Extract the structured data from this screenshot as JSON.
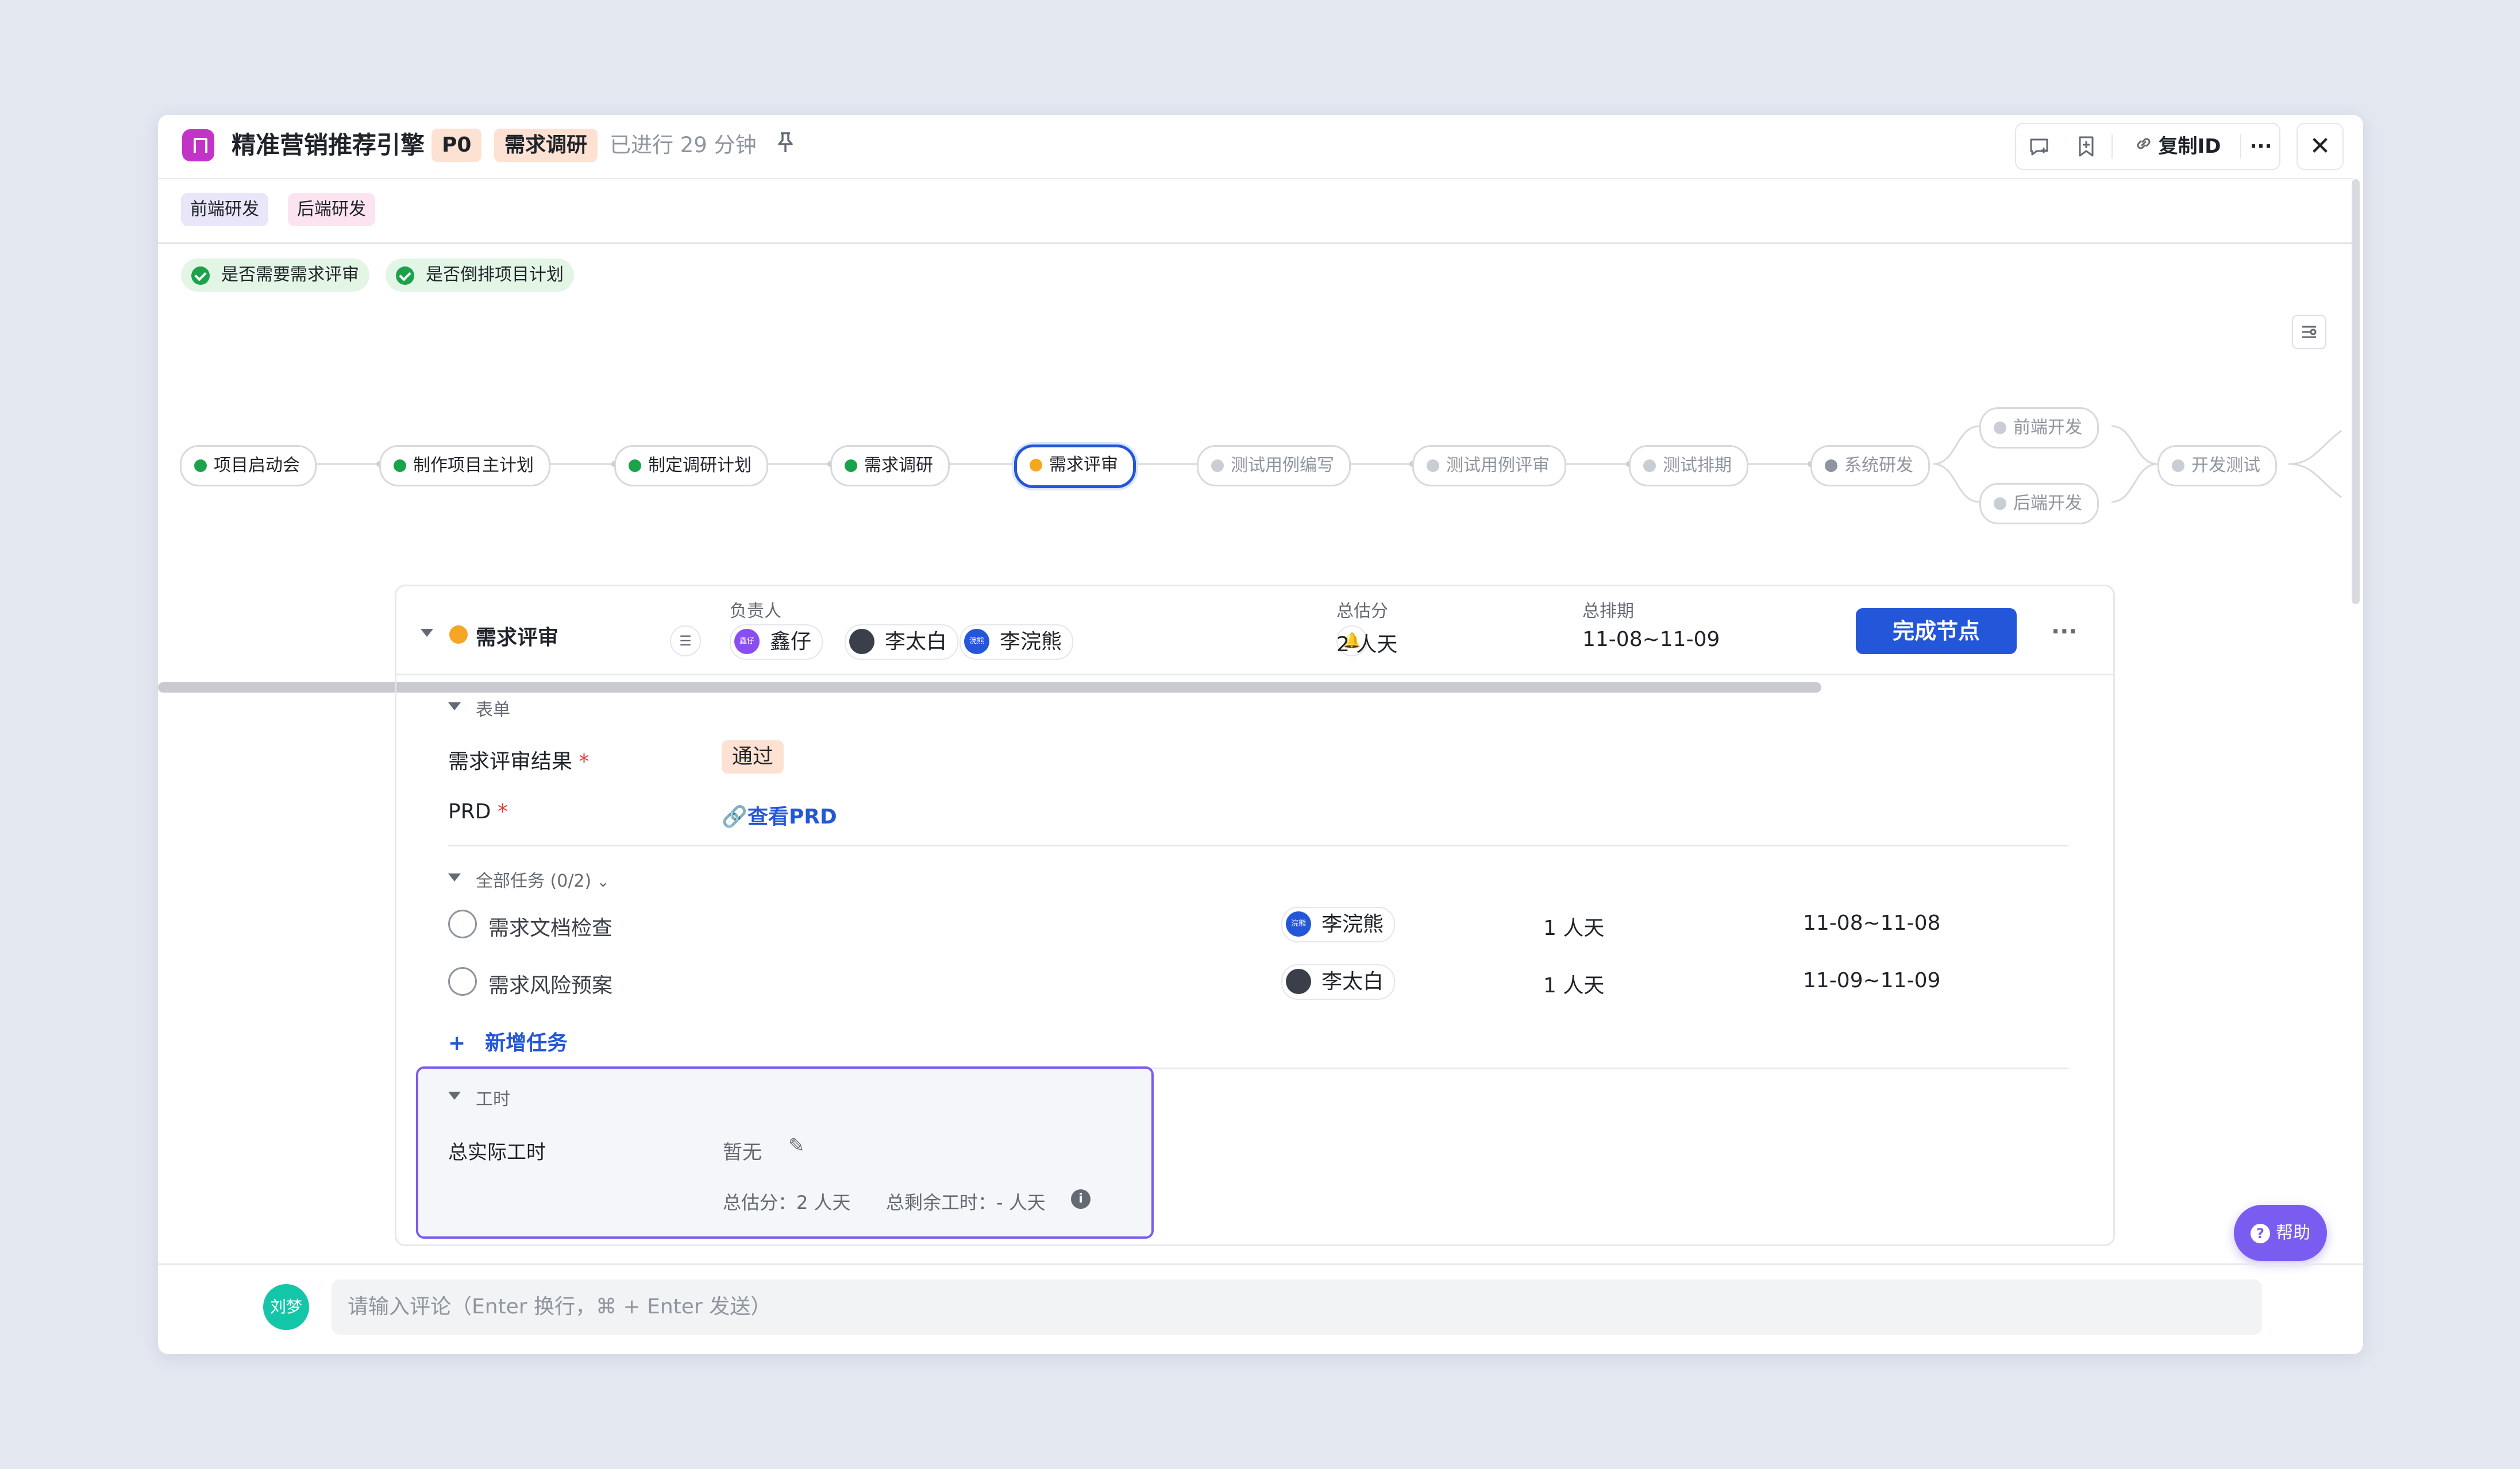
{
  "header": {
    "title": "精准营销推荐引擎",
    "priority": "P0",
    "stage": "需求调研",
    "elapsed": "已进行 29 分钟",
    "copy_id_label": "复制ID"
  },
  "tags": [
    "前端研发",
    "后端研发"
  ],
  "conditions": [
    "是否需要需求评审",
    "是否倒排项目计划"
  ],
  "flow": {
    "nodes": [
      {
        "label": "项目启动会",
        "status": "done"
      },
      {
        "label": "制作项目主计划",
        "status": "done"
      },
      {
        "label": "制定调研计划",
        "status": "done"
      },
      {
        "label": "需求调研",
        "status": "done"
      },
      {
        "label": "需求评审",
        "status": "current"
      },
      {
        "label": "测试用例编写",
        "status": "todo"
      },
      {
        "label": "测试用例评审",
        "status": "todo"
      },
      {
        "label": "测试排期",
        "status": "todo"
      },
      {
        "label": "系统研发",
        "status": "todo"
      },
      {
        "label": "前端开发",
        "status": "todo"
      },
      {
        "label": "后端开发",
        "status": "todo"
      },
      {
        "label": "开发测试",
        "status": "todo"
      }
    ]
  },
  "node_detail": {
    "name": "需求评审",
    "owner_label": "负责人",
    "owners": [
      "鑫仔",
      "李太白",
      "李浣熊"
    ],
    "estimate_label": "总估分",
    "estimate": "2 人天",
    "schedule_label": "总排期",
    "schedule": "11-08~11-09",
    "complete_label": "完成节点",
    "form": {
      "section_label": "表单",
      "fields": [
        {
          "label": "需求评审结果",
          "required": "*",
          "value": "通过"
        },
        {
          "label": "PRD",
          "required": "*",
          "value": "查看PRD"
        }
      ]
    },
    "tasks": {
      "section_label": "全部任务 (0/2)",
      "items": [
        {
          "name": "需求文档检查",
          "assignee": "李浣熊",
          "estimate": "1 人天",
          "schedule": "11-08~11-08"
        },
        {
          "name": "需求风险预案",
          "assignee": "李太白",
          "estimate": "1 人天",
          "schedule": "11-09~11-09"
        }
      ],
      "add_label": "新增任务"
    },
    "work_hours": {
      "section_label": "工时",
      "actual_label": "总实际工时",
      "actual_value": "暂无",
      "summary_estimate": "总估分：2 人天",
      "summary_remaining": "总剩余工时：- 人天"
    }
  },
  "avatar_tiny": {
    "xinzai": "鑫仔",
    "huanxiong": "浣熊"
  },
  "comment": {
    "user": "刘梦",
    "placeholder": "请输入评论（Enter 换行，⌘ + Enter 发送）"
  },
  "help_label": "帮助",
  "colors": {
    "accent": "#2356d9",
    "done": "#1aa34a",
    "current": "#f5a623",
    "highlight": "#7b5cf0"
  }
}
